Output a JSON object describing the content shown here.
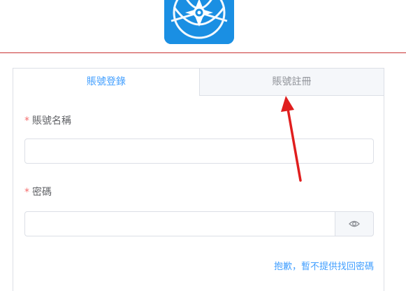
{
  "app": {
    "logo_icon": "compass-star-logo-icon"
  },
  "colors": {
    "accent": "#409eff",
    "divider": "#c93434",
    "required": "#f56c6c",
    "logo_bg": "#1a8fe3",
    "annotation_arrow": "#e01e1e"
  },
  "tabs": [
    {
      "label": "賬號登錄",
      "active": true
    },
    {
      "label": "賬號註冊",
      "active": false
    }
  ],
  "form": {
    "required_mark": "*",
    "account_name": {
      "label": "賬號名稱",
      "value": "",
      "placeholder": ""
    },
    "password": {
      "label": "密碼",
      "value": "",
      "placeholder": "",
      "toggle_icon": "eye-icon"
    },
    "sorry_link": "抱歉，暫不提供找回密碼"
  },
  "annotation": {
    "icon": "red-arrow-pointing-at-register-tab"
  }
}
